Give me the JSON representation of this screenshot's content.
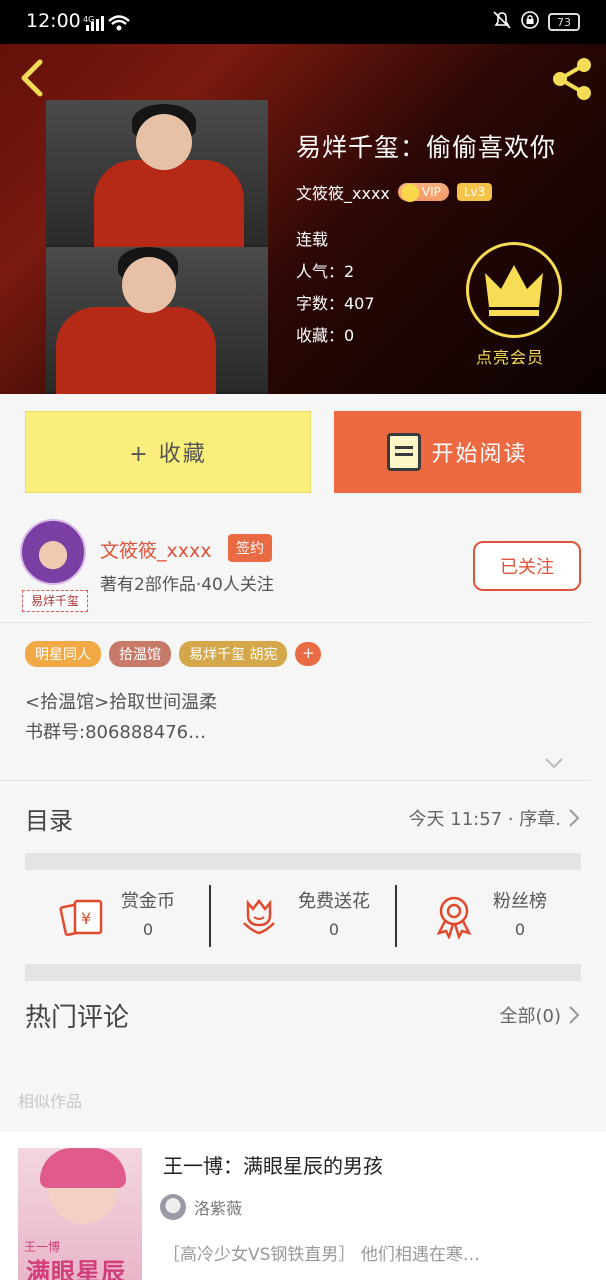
{
  "status_bar": {
    "time": "12:00",
    "network": "4G",
    "battery": "73"
  },
  "header": {
    "book_title": "易烊千玺：偷偷喜欢你",
    "author": "文筱筱_xxxx",
    "vip": "VIP",
    "level": "Lv3",
    "status": "连载",
    "popularity": "人气：2",
    "word_count": "字数：407",
    "favorites": "收藏：0",
    "member_label": "点亮会员"
  },
  "actions": {
    "collect": "+ 收藏",
    "read": "开始阅读"
  },
  "author_card": {
    "name": "文筱筱_xxxx",
    "badge": "签约",
    "stats": "著有2部作品·40人关注",
    "avatar_tag": "易烊千玺",
    "follow": "已关注"
  },
  "tags": [
    {
      "label": "明星同人",
      "color": "#f0a945"
    },
    {
      "label": "拾温馆",
      "color": "#c87a6a"
    },
    {
      "label": "易烊千玺 胡宪",
      "color": "#d4a84a"
    }
  ],
  "tag_add": "+",
  "description": [
    "<拾温馆>拾取世间温柔",
    "书群号:806888476…"
  ],
  "catalog": {
    "label": "目录",
    "latest": "今天 11:57 · 序章."
  },
  "rewards": [
    {
      "label": "赏金币",
      "value": "0",
      "icon": "money-envelope-icon"
    },
    {
      "label": "免费送花",
      "value": "0",
      "icon": "flower-icon"
    },
    {
      "label": "粉丝榜",
      "value": "0",
      "icon": "ribbon-medal-icon"
    }
  ],
  "comments": {
    "label": "热门评论",
    "all": "全部(0)"
  },
  "similar": {
    "label": "相似作品",
    "title": "王一博：满眼星辰的男孩",
    "author": "洛紫薇",
    "desc": "［高冷少女VS钢铁直男］ 他们相遇在寒…",
    "cover_text_small": "王一博",
    "cover_text_big": "满眼星辰"
  }
}
